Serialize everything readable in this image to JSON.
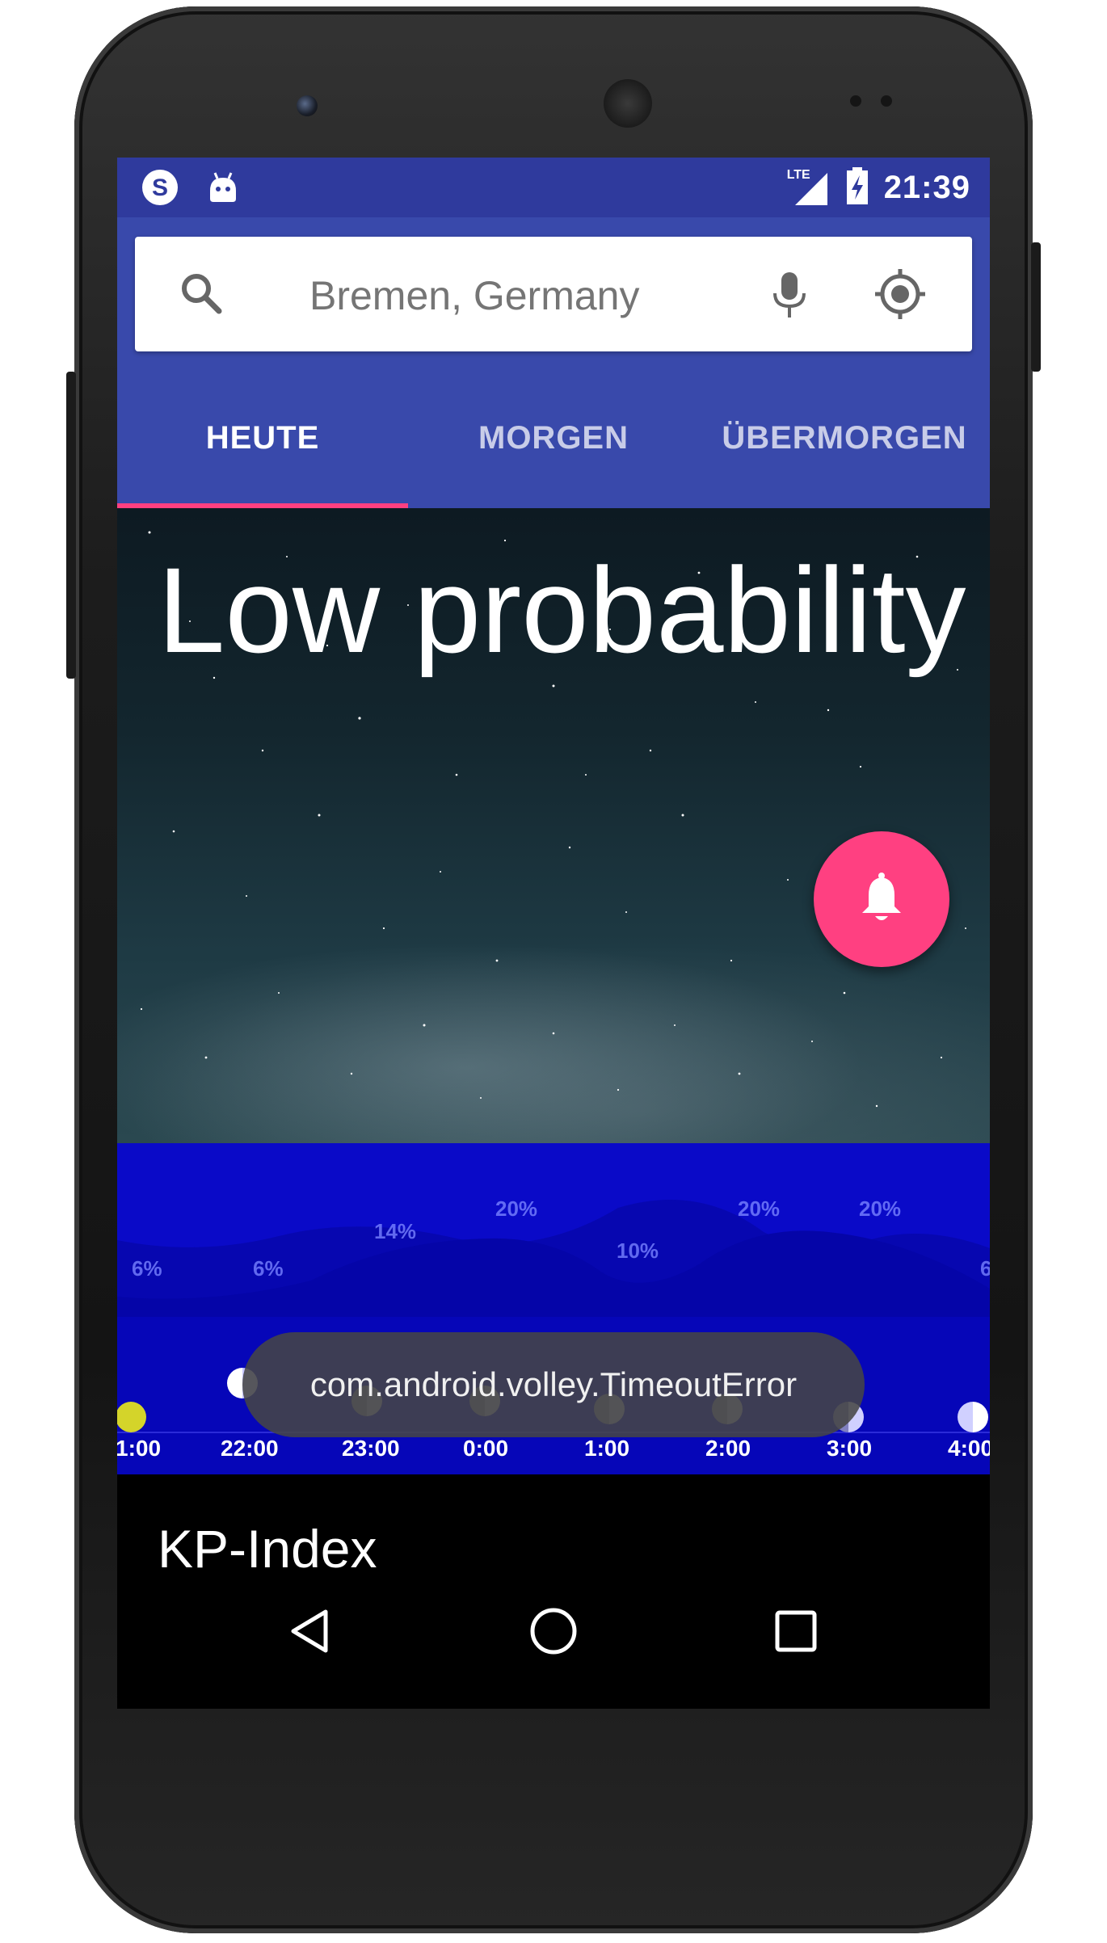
{
  "status_bar": {
    "time": "21:39",
    "network": "LTE",
    "icons": [
      "skype-icon",
      "android-icon",
      "signal-icon",
      "battery-icon"
    ]
  },
  "search": {
    "value": "Bremen, Germany",
    "icons": [
      "search-icon",
      "mic-icon",
      "my-location-icon"
    ]
  },
  "tabs": [
    {
      "label": "HEUTE",
      "active": true
    },
    {
      "label": "MORGEN",
      "active": false
    },
    {
      "label": "ÜBERMORGEN",
      "active": false
    }
  ],
  "hero": {
    "title": "Low probability",
    "fab_icon": "bell-icon"
  },
  "forecast": {
    "percentages": [
      "6%",
      "6%",
      "14%",
      "20%",
      "10%",
      "20%",
      "20%",
      "6"
    ],
    "times": [
      "1:00",
      "22:00",
      "23:00",
      "0:00",
      "1:00",
      "2:00",
      "3:00",
      "4:00"
    ]
  },
  "toast": {
    "message": "com.android.volley.TimeoutError"
  },
  "section": {
    "title": "KP-Index"
  },
  "navigation": {
    "icons": [
      "back-icon",
      "home-icon",
      "recents-icon"
    ]
  },
  "colors": {
    "primary": "#3949ab",
    "primary_dark": "#2f3a9d",
    "accent": "#ff4081",
    "forecast_bg": "#0a0ac8"
  }
}
